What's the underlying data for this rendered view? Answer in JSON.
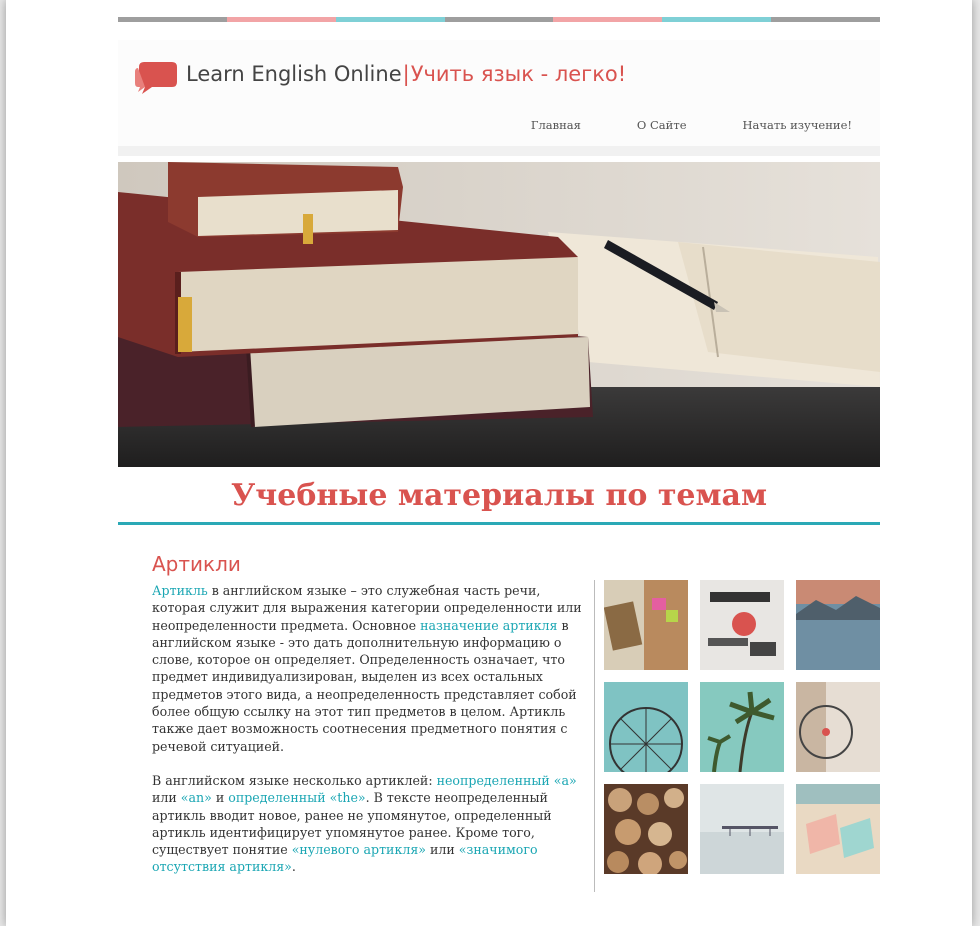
{
  "colors": {
    "accent_red": "#d9534f",
    "accent_teal": "#2aa9b6",
    "stripe": [
      "#9e9e9e",
      "#f2a4a6",
      "#7fd0d6",
      "#9e9e9e",
      "#f2a4a6",
      "#7fd0d6",
      "#9e9e9e"
    ]
  },
  "header": {
    "brand": "Learn English Online",
    "separator": "|",
    "tagline": "Учить язык - легко!",
    "logo_icon": "speech-bubble-icon"
  },
  "nav": [
    {
      "label": "Главная"
    },
    {
      "label": "О Сайте"
    },
    {
      "label": "Начать изучение!"
    }
  ],
  "hero": {
    "image": "books-and-pen-photo"
  },
  "section_title": "Учебные материалы по темам",
  "article": {
    "title": "Артикли",
    "p1": {
      "link_article": "Артикль",
      "t1": " в английском языке – это служебная часть речи, которая служит для выражения категории определенности или неопределенности предмета. Основное ",
      "link_purpose": "назначение артикля",
      "t2": " в английском языке - это дать дополнительную информацию о слове, которое он определяет. Определенность означает, что предмет индивидуализирован, выделен из всех остальных предметов этого вида, а неопределенность представляет собой более общую ссылку на этот тип предметов в целом. Артикль также дает возможность соотнесения предметного понятия с речевой ситуацией."
    },
    "p2": {
      "t1": "В английском языке несколько артиклей: ",
      "link_indef": "неопределенный «a»",
      "t2": " или ",
      "link_an": "«an»",
      "t3": " и ",
      "link_def": "определенный «the»",
      "t4": ". В тексте неопределенный артикль вводит новое, ранее не упомянутое, определенный артикль идентифицирует упомянутое ранее. Кроме того, существует понятие ",
      "link_zero": "«нулевого артикля»",
      "t5": " или ",
      "link_sig": "«значимого отсутствия артикля»",
      "t6": "."
    }
  },
  "gallery": [
    "map-notebook-photo",
    "typography-collage-photo",
    "lake-mountains-photo",
    "ferris-wheel-photo",
    "palm-trees-photo",
    "bicycle-photo",
    "wood-logs-photo",
    "pier-fog-photo",
    "beach-chairs-photo"
  ]
}
